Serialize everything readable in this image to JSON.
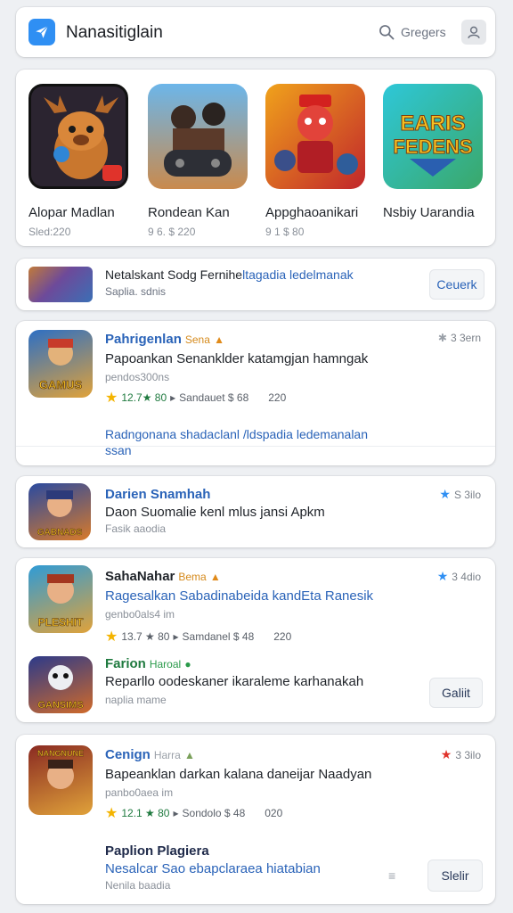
{
  "header": {
    "app_title": "Nanasitiglain",
    "search_label": "Gregers",
    "colors": {
      "accent": "#2f8ff3"
    }
  },
  "featured": [
    {
      "name": "Alopar Madlan",
      "meta": "Sled:220",
      "icon": "moose-character-icon"
    },
    {
      "name": "Rondean Kan",
      "meta": "9 6. $ 220",
      "icon": "gamepad-heroes-icon"
    },
    {
      "name": "Appghaoanikari",
      "meta": "9 1 $ 80",
      "icon": "red-warrior-icon"
    },
    {
      "name": "Nsbiy Uarandia",
      "meta": "",
      "icon": "earis-fedens-logo-icon",
      "logo_text": "EARIS FEDENS"
    }
  ],
  "banner": {
    "title_a": "Netalskant Sodg Fernihe",
    "title_b": "ltagadia ledelmanak",
    "subtitle": "Saplia. sdnis",
    "button": "Ceuerk"
  },
  "list": [
    {
      "title": "Pahrigenlan",
      "tag": "Sena",
      "tag_icon": "fire-icon",
      "side": "3 3ern",
      "side_icon": "puzzle-icon",
      "line": "Papoankan Senanklder katamgjan hamngak",
      "sub": "pendos300ns",
      "rating": "12.7★ 80",
      "stat": "Sandauet $ 68",
      "count": "220",
      "link": "Radngonana shadaclanl /ldspadia ledemanalan ssan",
      "icon_text": "GAMUS"
    },
    {
      "title": "Darien Snamhah",
      "side": "S 3ilo",
      "side_icon": "star-icon",
      "line": "Daon Suomalie kenl mlus jansi Apkm",
      "sub": "Fasik aaodia",
      "icon_text": "GABNADS"
    },
    {
      "title": "SahaNahar",
      "tag": "Bema",
      "tag_icon": "fire-icon",
      "side": "3 4dio",
      "side_icon": "star-icon",
      "line": "Ragesalkan Sabadinabeida kandEta Ranesik",
      "sub": "genbo0als4 im",
      "rating": "13.7 ★ 80",
      "stat": "Samdanel $ 48",
      "count": "220",
      "icon_text": "PLESHIT"
    },
    {
      "title": "Farion",
      "tag": "Haroal",
      "tag_icon": "leaf-icon",
      "line": "Reparllo oodeskaner ikaraleme karhanakah",
      "sub": "naplia mame",
      "button": "Galiit",
      "icon_text": "GANSIMS"
    },
    {
      "title": "Cenign",
      "tag": "Harra",
      "tag_icon": "leaf-icon",
      "side": "3 3ilo",
      "side_icon": "star-icon",
      "line": "Bapeanklan darkan kalana daneijar Naadyan",
      "sub": "panbo0aea im",
      "rating": "12.1 ★ 80",
      "stat": "Sondolo $ 48",
      "count": "020",
      "icon_text": "NANGNUNE"
    },
    {
      "title": "Paplion Plagiera",
      "line": "Nesalcar Sao ebapclaraea hiatabian",
      "sub": "Nenila baadia",
      "button": "Slelir",
      "side_icon": "sort-icon"
    }
  ]
}
